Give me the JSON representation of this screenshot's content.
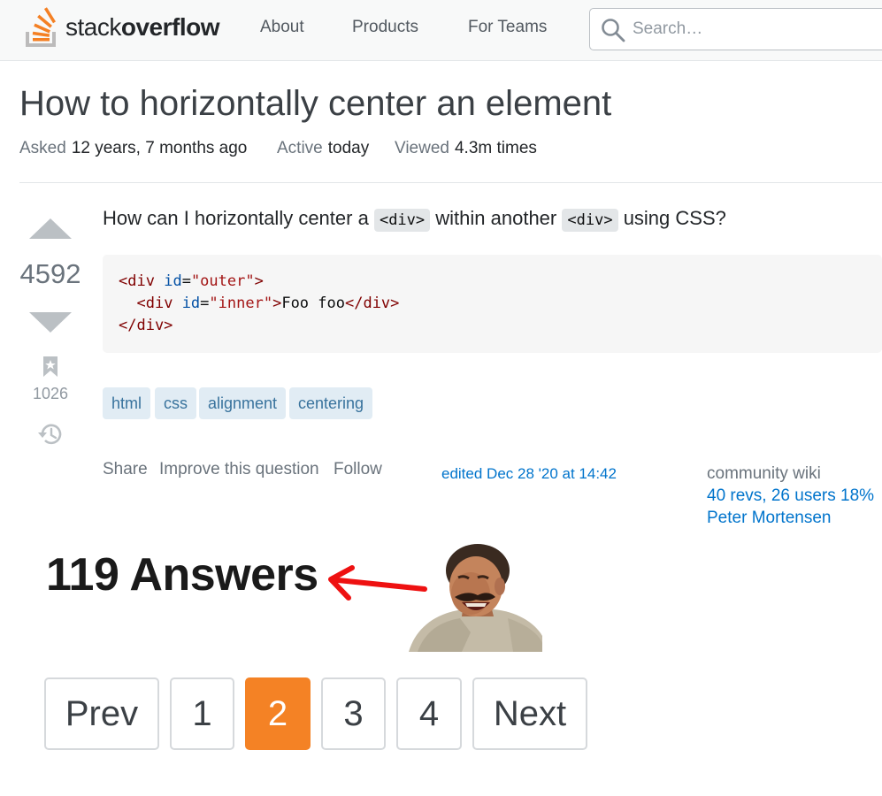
{
  "header": {
    "logo_text_light": "stack",
    "logo_text_bold": "overflow",
    "logo_icon": "stackoverflow-logo-icon",
    "nav": [
      "About",
      "Products",
      "For Teams"
    ],
    "search_placeholder": "Search…",
    "search_icon": "search-icon"
  },
  "question": {
    "title": "How to horizontally center an element",
    "meta": [
      {
        "label": "Asked",
        "value": "12 years, 7 months ago"
      },
      {
        "label": "Active",
        "value": "today"
      },
      {
        "label": "Viewed",
        "value": "4.3m times"
      }
    ],
    "votes": "4592",
    "bookmarks": "1026",
    "body_parts": [
      "How can I horizontally center a",
      "<div>",
      "within another",
      "<div>",
      "using CSS?"
    ],
    "code_lines": [
      [
        [
          "tag",
          "<div"
        ],
        [
          "txt",
          " "
        ],
        [
          "attr",
          "id"
        ],
        [
          "txt",
          "="
        ],
        [
          "str",
          "\"outer\""
        ],
        [
          "tag",
          ">"
        ]
      ],
      [
        [
          "txt",
          "  "
        ],
        [
          "tag",
          "<div"
        ],
        [
          "txt",
          " "
        ],
        [
          "attr",
          "id"
        ],
        [
          "txt",
          "="
        ],
        [
          "str",
          "\"inner\""
        ],
        [
          "tag",
          ">"
        ],
        [
          "txt",
          "Foo foo"
        ],
        [
          "tag",
          "</div>"
        ]
      ],
      [
        [
          "tag",
          "</div>"
        ]
      ]
    ],
    "tags": [
      "html",
      "css",
      "alignment",
      "centering"
    ],
    "post_menu": [
      "Share",
      "Improve this question",
      "Follow"
    ],
    "edited": "edited Dec 28 '20 at 14:42",
    "community_wiki": "community wiki",
    "revs": "40 revs, 26 users 18%",
    "editor": "Peter Mortensen"
  },
  "answers": {
    "count_label": "119 Answers"
  },
  "pagination": {
    "pages": [
      "Prev",
      "1",
      "2",
      "3",
      "4",
      "Next"
    ],
    "current": "2"
  },
  "colors": {
    "accent": "#f48225",
    "link": "#0074cc",
    "tag_bg": "#e1ecf4",
    "tag_fg": "#39739d",
    "arrow": "#ee1111"
  }
}
